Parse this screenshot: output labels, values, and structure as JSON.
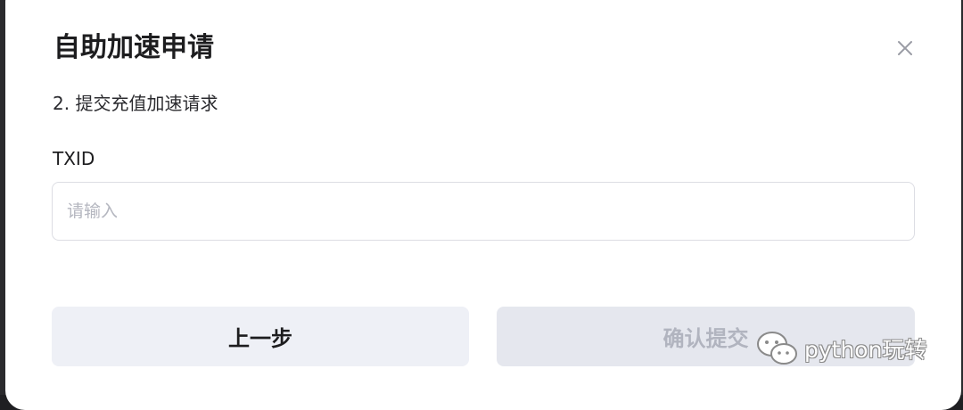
{
  "dialog": {
    "title": "自助加速申请",
    "close_icon": "close-icon",
    "step_label": "2. 提交充值加速请求",
    "field": {
      "label": "TXID",
      "placeholder": "请输入",
      "value": ""
    },
    "buttons": {
      "prev_label": "上一步",
      "submit_label": "确认提交",
      "submit_disabled": true
    }
  },
  "watermark": {
    "icon": "wechat-icon",
    "text": "python玩转"
  },
  "colors": {
    "modal_bg": "#ffffff",
    "backdrop": "#1f1f22",
    "prev_button_bg": "#eef0f6",
    "submit_button_bg": "#e5e7ee",
    "submit_text_disabled": "#b1b4bf",
    "input_border": "#dcdde3"
  }
}
